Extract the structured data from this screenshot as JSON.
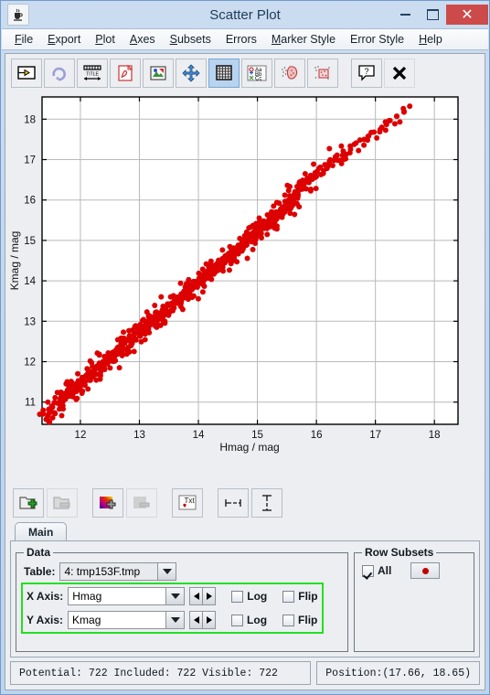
{
  "window": {
    "title": "Scatter Plot",
    "icon": "java-coffee-cup-icon",
    "minimize_label": "",
    "maximize_label": "",
    "close_label": "✕"
  },
  "menu": {
    "items": [
      {
        "label": "File",
        "mnemonic": "F"
      },
      {
        "label": "Export",
        "mnemonic": "E"
      },
      {
        "label": "Plot",
        "mnemonic": "P"
      },
      {
        "label": "Axes",
        "mnemonic": "A"
      },
      {
        "label": "Subsets",
        "mnemonic": "S"
      },
      {
        "label": "Errors",
        "mnemonic": "E"
      },
      {
        "label": "Marker Style",
        "mnemonic": "M"
      },
      {
        "label": "Error Style",
        "mnemonic": "E"
      },
      {
        "label": "Help",
        "mnemonic": "H"
      }
    ]
  },
  "toolbar_top": {
    "buttons": [
      {
        "name": "replot-button",
        "icon": "replot-icon",
        "selected": false
      },
      {
        "name": "rescale-button",
        "icon": "circular-arrow-icon",
        "selected": false
      },
      {
        "name": "axes-title-button",
        "icon": "title-ruler-icon",
        "selected": false
      },
      {
        "name": "export-pdf-button",
        "icon": "pdf-icon",
        "selected": false
      },
      {
        "name": "export-image-button",
        "icon": "image-icon",
        "selected": false
      },
      {
        "name": "pan-button",
        "icon": "move-arrows-icon",
        "selected": false
      },
      {
        "name": "grid-toggle-button",
        "icon": "grid-icon",
        "selected": true
      },
      {
        "name": "label-points-button",
        "icon": "abc-labels-icon",
        "selected": false
      },
      {
        "name": "blob-subset-button",
        "icon": "blob-select-icon",
        "selected": false
      },
      {
        "name": "box-subset-button",
        "icon": "box-select-icon",
        "selected": false
      },
      {
        "name": "help-button",
        "icon": "question-mark-icon",
        "selected": false
      },
      {
        "name": "close-button",
        "icon": "x-mark-icon",
        "selected": false
      }
    ]
  },
  "toolbar_bottom": {
    "buttons": [
      {
        "name": "add-layer-button",
        "icon": "add-stack-icon",
        "enabled": true
      },
      {
        "name": "remove-layer-button",
        "icon": "remove-stack-icon",
        "enabled": false
      },
      {
        "name": "add-style-button",
        "icon": "color-add-icon",
        "enabled": true
      },
      {
        "name": "remove-style-button",
        "icon": "gray-remove-icon",
        "enabled": false
      },
      {
        "name": "text-label-button",
        "icon": "txt-icon",
        "enabled": true
      },
      {
        "name": "x-error-button",
        "icon": "horizontal-errorbar-icon",
        "enabled": true
      },
      {
        "name": "y-error-button",
        "icon": "vertical-errorbar-icon",
        "enabled": true
      }
    ]
  },
  "tabs": [
    {
      "label": "Main",
      "active": true
    }
  ],
  "data_group": {
    "legend": "Data",
    "table_label": "Table:",
    "table_value": "4: tmp153F.tmp",
    "x_axis_label": "X Axis:",
    "x_axis_value": "Hmag",
    "y_axis_label": "Y Axis:",
    "y_axis_value": "Kmag",
    "log_label": "Log",
    "flip_label": "Flip",
    "x_log_checked": false,
    "x_flip_checked": false,
    "y_log_checked": false,
    "y_flip_checked": false,
    "highlight_color": "#22e022"
  },
  "subsets_group": {
    "legend": "Row Subsets",
    "all_label": "All",
    "all_checked": true,
    "marker_color": "#c00000"
  },
  "status": {
    "counts": "Potential: 722 Included: 722 Visible: 722",
    "position": "Position:(17.66, 18.65)"
  },
  "chart_data": {
    "type": "scatter",
    "title": "",
    "xlabel": "Hmag / mag",
    "ylabel": "Kmag / mag",
    "xlim": [
      11.35,
      18.4
    ],
    "ylim": [
      10.45,
      18.55
    ],
    "xticks": [
      12,
      13,
      14,
      15,
      16,
      17,
      18
    ],
    "yticks": [
      11,
      12,
      13,
      14,
      15,
      16,
      17,
      18
    ],
    "grid": true,
    "legend": "none",
    "point_color": "#dd0000",
    "point_size": 3,
    "n_points": 722,
    "series": [
      {
        "name": "All",
        "x": [
          11.42,
          11.45,
          11.47,
          11.43,
          11.5,
          11.52,
          11.48,
          11.55,
          11.57,
          11.54,
          11.6,
          11.62,
          11.58,
          11.65,
          11.67,
          11.63,
          11.7,
          11.72,
          11.68,
          11.74,
          11.76,
          11.73,
          11.78,
          11.8,
          11.77,
          11.82,
          11.84,
          11.81,
          11.86,
          11.88,
          11.85,
          11.9,
          11.92,
          11.89,
          11.94,
          11.96,
          11.93,
          11.98,
          12.0,
          11.97,
          12.02,
          12.04,
          12.01,
          12.06,
          12.08,
          12.05,
          12.1,
          12.12,
          12.09,
          12.14,
          12.16,
          12.13,
          12.18,
          12.2,
          12.17,
          12.22,
          12.24,
          12.21,
          12.26,
          12.28,
          12.25,
          12.3,
          12.32,
          12.29,
          12.34,
          12.36,
          12.33,
          12.38,
          12.4,
          12.37,
          12.42,
          12.44,
          12.41,
          12.46,
          12.48,
          12.45,
          12.5,
          12.52,
          12.49,
          12.54,
          12.56,
          12.53,
          12.58,
          12.6,
          12.57,
          12.62,
          12.64,
          12.61,
          12.66,
          12.68,
          12.65,
          12.7,
          12.72,
          12.69,
          12.74,
          12.76,
          12.73,
          12.78,
          12.8,
          12.77,
          12.82,
          12.84,
          12.81,
          12.86,
          12.88,
          12.85,
          12.9,
          12.92,
          12.89,
          12.94,
          12.96,
          12.93,
          12.98,
          13.0,
          12.97,
          13.02,
          13.04,
          13.01,
          13.06,
          13.08,
          13.05,
          13.1,
          13.12,
          13.09,
          13.14,
          13.16,
          13.13,
          13.18,
          13.2,
          13.17,
          13.22,
          13.24,
          13.21,
          13.26,
          13.28,
          13.25,
          13.3,
          13.32,
          13.29,
          13.34,
          13.36,
          13.33,
          13.38,
          13.4,
          13.37,
          13.42,
          13.44,
          13.41,
          13.46,
          13.48,
          13.45,
          13.5,
          13.52,
          13.49,
          13.54,
          13.56,
          13.53,
          13.58,
          13.6,
          13.57,
          13.62,
          13.64,
          13.61,
          13.66,
          13.68,
          13.65,
          13.7,
          13.72,
          13.69,
          13.74,
          13.76,
          13.73,
          13.78,
          13.8,
          13.77,
          13.82,
          13.84,
          13.81,
          13.86,
          13.88,
          13.85,
          13.9,
          13.92,
          13.89,
          13.94,
          13.96,
          13.93,
          13.98,
          14.0,
          13.97,
          14.02,
          14.04,
          14.01,
          14.06,
          14.08,
          14.05,
          14.1,
          14.12,
          14.09,
          14.14,
          14.16,
          14.13,
          14.18,
          14.2,
          14.17,
          14.22,
          14.24,
          14.21,
          14.26,
          14.28,
          14.25,
          14.3,
          14.32,
          14.29,
          14.34,
          14.36,
          14.33,
          14.38,
          14.4,
          14.37,
          14.42,
          14.44,
          14.41,
          14.46,
          14.48,
          14.45,
          14.5,
          14.52,
          14.49,
          14.54,
          14.56,
          14.53,
          14.58,
          14.6,
          14.57,
          14.62,
          14.64,
          14.61,
          14.66,
          14.68,
          14.65,
          14.7,
          14.72,
          14.69,
          14.74,
          14.76,
          14.73,
          14.78,
          14.8,
          14.77,
          14.82,
          14.84,
          14.81,
          14.86,
          14.88,
          14.85,
          14.9,
          14.92,
          14.89,
          14.94,
          14.96,
          14.93,
          14.98,
          15.0,
          14.97,
          15.02,
          15.04,
          15.01,
          15.06,
          15.08,
          15.05,
          15.1,
          15.12,
          15.09,
          15.14,
          15.16,
          15.13,
          15.18,
          15.2,
          15.17,
          15.22,
          15.24,
          15.21,
          15.26,
          15.28,
          15.25,
          15.3,
          15.32,
          15.29,
          15.34,
          15.36,
          15.33,
          15.38,
          15.4,
          15.37,
          15.42,
          15.44,
          15.41,
          15.46,
          15.48,
          15.45,
          15.5,
          15.52,
          15.49,
          15.54,
          15.56,
          15.53,
          15.58,
          15.6,
          15.57,
          15.62,
          15.64,
          15.61,
          15.66,
          15.68,
          15.65,
          15.7,
          15.72,
          15.69,
          15.74,
          15.76,
          15.73,
          15.78,
          15.8,
          15.77,
          15.85,
          15.9,
          15.88,
          15.95,
          16.0,
          15.98,
          16.05,
          16.1,
          16.08,
          16.15,
          16.2,
          16.18,
          16.25,
          16.3,
          16.28,
          16.35,
          16.4,
          16.38,
          16.45,
          16.5,
          16.48,
          16.55,
          16.6,
          16.58,
          16.65,
          16.7,
          16.68,
          16.75,
          16.8,
          16.78,
          16.85,
          16.9,
          16.88,
          16.95,
          17.0,
          16.98,
          17.05,
          17.1,
          17.08,
          17.15,
          17.2,
          17.18,
          17.25,
          17.3,
          17.28,
          17.35,
          17.4,
          17.38,
          17.45,
          17.5,
          17.48,
          17.55,
          17.6,
          17.58,
          17.65,
          17.7,
          17.68,
          17.75,
          17.8,
          17.78,
          17.85,
          17.9,
          17.88,
          17.95,
          18.0,
          17.98,
          18.05,
          18.1,
          18.08,
          18.15,
          18.2,
          18.25,
          18.3,
          18.35
        ],
        "y": [
          10.6,
          10.65,
          10.55,
          10.7,
          10.75,
          10.62,
          10.8,
          10.85,
          10.72,
          10.9,
          10.95,
          10.82,
          11.0,
          11.05,
          10.92,
          11.1,
          11.12,
          11.0,
          11.15,
          11.18,
          11.08,
          11.2,
          11.22,
          11.12,
          11.25,
          11.28,
          11.18,
          11.3,
          11.32,
          11.22,
          11.35,
          11.38,
          11.28,
          11.4,
          11.42,
          11.32,
          11.45,
          11.48,
          11.38,
          11.5,
          11.52,
          11.42,
          11.55,
          11.58,
          11.48,
          11.6,
          11.62,
          11.52,
          11.65,
          11.68,
          11.58,
          11.7,
          11.72,
          11.62,
          11.75,
          11.78,
          11.68,
          11.8,
          11.82,
          11.72,
          11.85,
          11.88,
          11.78,
          11.9,
          11.92,
          11.82,
          11.95,
          11.98,
          11.88,
          12.0,
          12.02,
          11.92,
          12.05,
          12.08,
          11.98,
          12.1,
          12.12,
          12.02,
          12.15,
          12.18,
          12.08,
          12.2,
          12.22,
          12.12,
          12.25,
          12.28,
          12.18,
          12.3,
          12.32,
          12.22,
          12.35,
          12.38,
          12.28,
          12.4,
          12.42,
          12.32,
          12.45,
          12.48,
          12.38,
          12.5,
          12.52,
          12.42,
          12.55,
          12.58,
          12.48,
          12.6,
          12.62,
          12.52,
          12.65,
          12.68,
          12.58,
          12.7,
          12.72,
          12.62,
          12.75,
          12.78,
          12.68,
          12.8,
          12.82,
          12.72,
          12.85,
          12.88,
          12.78,
          12.9,
          12.92,
          12.82,
          12.95,
          12.98,
          12.88,
          13.0,
          13.02,
          12.92,
          13.05,
          13.08,
          12.98,
          13.1,
          13.12,
          13.02,
          13.15,
          13.18,
          13.08,
          13.2,
          13.22,
          13.12,
          13.25,
          13.28,
          13.18,
          13.3,
          13.32,
          13.22,
          13.35,
          13.38,
          13.28,
          13.4,
          13.42,
          13.32,
          13.45,
          13.48,
          13.38,
          13.5,
          13.52,
          13.42,
          13.55,
          13.58,
          13.48,
          13.6,
          13.62,
          13.52,
          13.65,
          13.68,
          13.58,
          13.7,
          13.72,
          13.62,
          13.75,
          13.78,
          13.68,
          13.8,
          13.82,
          13.72,
          13.85,
          13.88,
          13.78,
          13.9,
          13.92,
          13.82,
          13.95,
          13.98,
          13.88,
          14.0,
          14.02,
          13.92,
          14.05,
          14.08,
          13.98,
          14.1,
          14.12,
          14.02,
          14.15,
          14.18,
          14.08,
          14.2,
          14.22,
          14.12,
          14.25,
          14.28,
          14.18,
          14.3,
          14.32,
          14.22,
          14.35,
          14.38,
          14.28,
          14.4,
          14.42,
          14.32,
          14.45,
          14.48,
          14.38,
          14.5,
          14.52,
          14.42,
          14.55,
          14.58,
          14.48,
          14.6,
          14.62,
          14.52,
          14.65,
          14.68,
          14.58,
          14.7,
          14.72,
          14.62,
          14.75,
          14.78,
          14.68,
          14.8,
          14.82,
          14.72,
          14.85,
          14.88,
          14.78,
          14.9,
          14.92,
          14.82,
          14.95,
          14.98,
          14.88,
          15.0,
          15.02,
          14.92,
          15.05,
          15.08,
          14.98,
          15.1,
          15.12,
          15.02,
          15.15,
          15.18,
          15.08,
          15.2,
          15.22,
          15.12,
          15.25,
          15.28,
          15.18,
          15.3,
          15.32,
          15.22,
          15.35,
          15.38,
          15.28,
          15.4,
          15.42,
          15.32,
          15.45,
          15.48,
          15.38,
          15.5,
          15.52,
          15.42,
          15.55,
          15.58,
          15.48,
          15.6,
          15.62,
          15.52,
          15.65,
          15.68,
          15.58,
          15.7,
          15.72,
          15.62,
          15.75,
          15.78,
          15.68,
          15.8,
          15.82,
          15.72,
          15.85,
          15.88,
          15.78,
          15.9,
          15.92,
          15.82,
          15.95,
          15.98,
          15.88,
          16.0,
          16.05,
          15.95,
          16.1,
          16.15,
          16.05,
          16.2,
          16.25,
          16.15,
          16.3,
          16.35,
          16.25,
          16.4,
          16.45,
          16.35,
          16.5,
          16.55,
          16.45,
          16.6,
          16.65,
          16.55,
          16.7,
          16.75,
          16.65,
          16.8,
          16.85,
          16.75,
          16.9,
          16.95,
          16.85,
          17.0,
          17.05,
          16.95,
          17.1,
          17.15,
          17.05,
          17.2,
          17.25,
          17.15,
          17.3,
          17.35,
          17.25,
          17.4,
          17.45,
          17.35,
          17.5,
          17.55,
          17.45,
          17.6,
          17.65,
          17.55,
          17.7,
          17.75,
          17.65,
          17.8,
          17.85,
          17.75,
          17.9,
          17.95,
          17.85,
          18.0,
          18.05,
          17.95,
          18.1,
          18.15,
          18.2,
          18.25,
          18.3
        ]
      }
    ]
  }
}
